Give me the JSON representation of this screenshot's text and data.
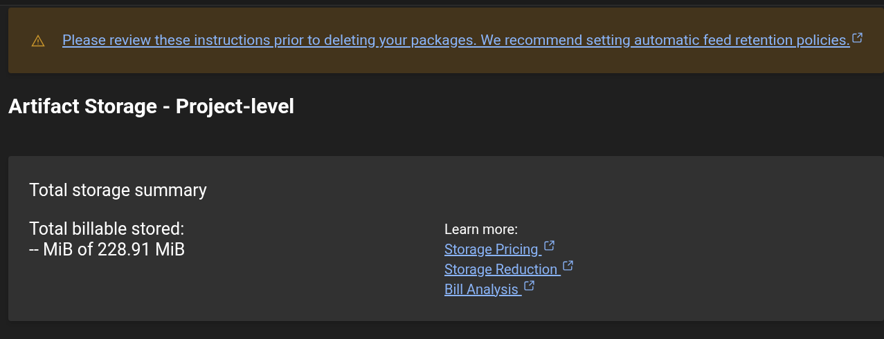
{
  "banner": {
    "text": "Please review these instructions prior to deleting your packages. We recommend setting automatic feed retention policies."
  },
  "heading": "Artifact Storage - Project-level",
  "summary": {
    "title": "Total storage summary",
    "billable_label": "Total billable stored:",
    "billable_value": "-- MiB of 228.91 MiB",
    "learn_more": "Learn more:",
    "links": [
      {
        "label": "Storage Pricing"
      },
      {
        "label": "Storage Reduction"
      },
      {
        "label": "Bill Analysis"
      }
    ]
  }
}
